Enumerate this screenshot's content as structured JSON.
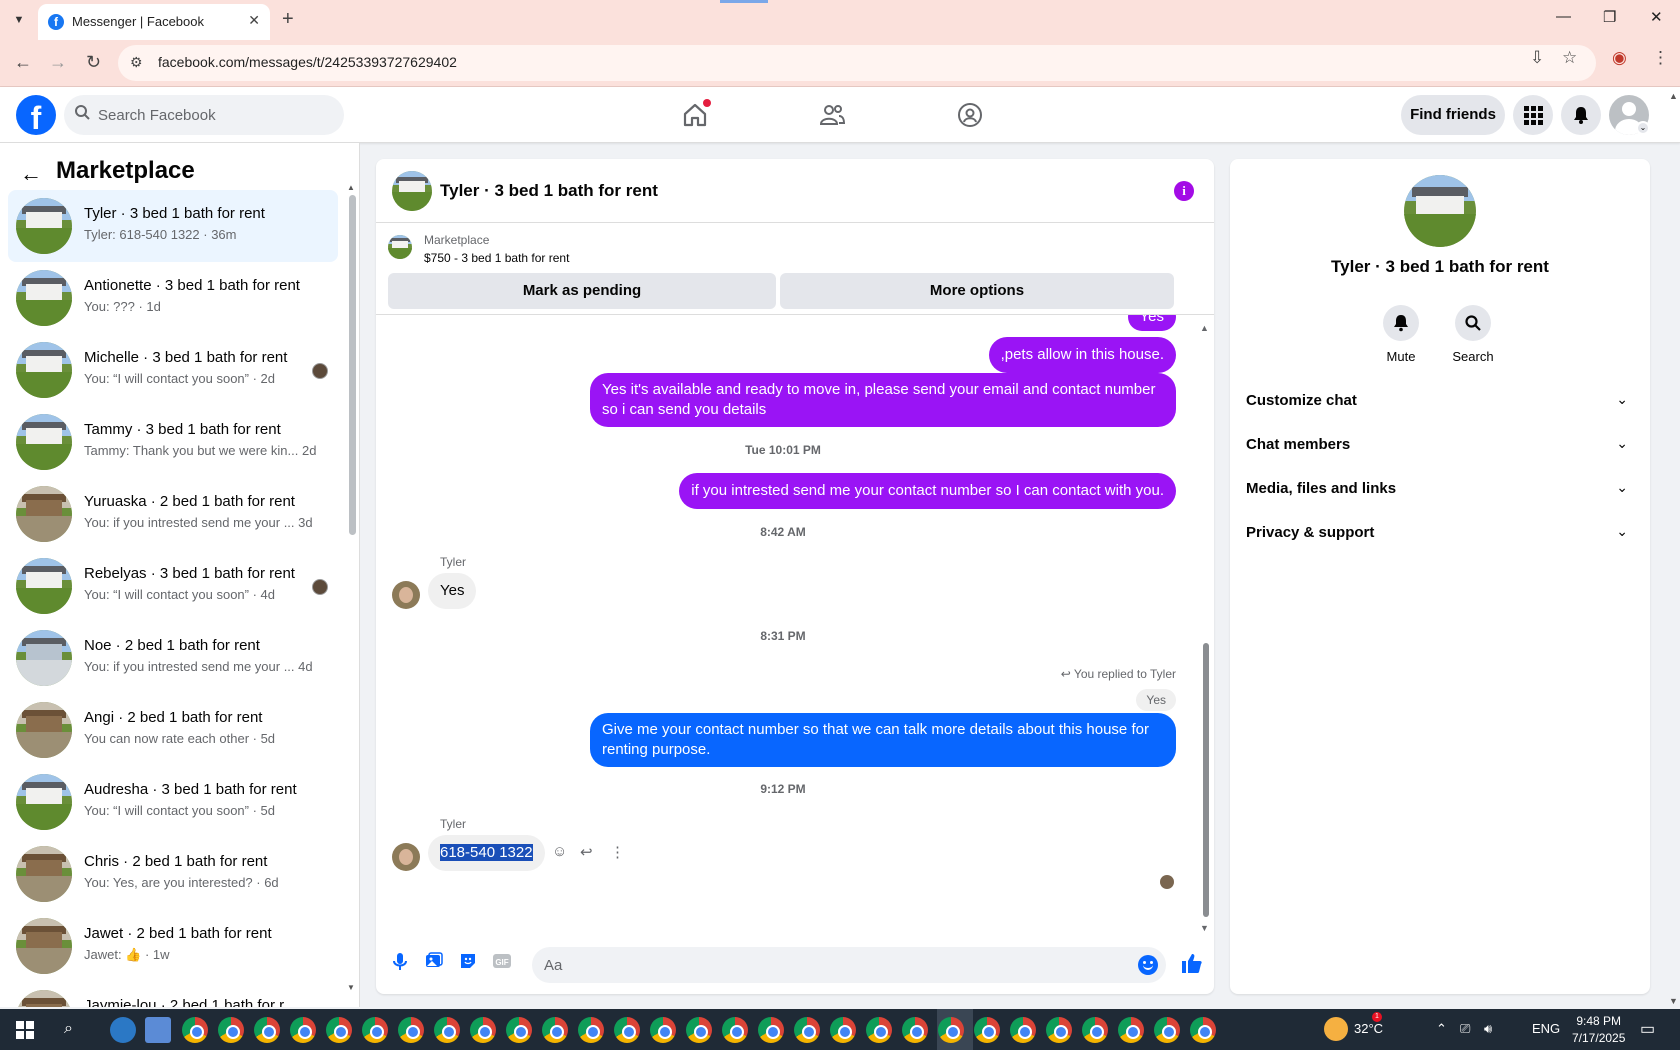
{
  "browser": {
    "tab_title": "Messenger | Facebook",
    "url": "facebook.com/messages/t/24253393727629402"
  },
  "fb_nav": {
    "search_placeholder": "Search Facebook",
    "find_friends": "Find friends"
  },
  "sidebar": {
    "title": "Marketplace",
    "chats": [
      {
        "name": "Tyler · 3 bed 1 bath for rent",
        "preview": "Tyler: 618-540 1322 · 36m",
        "active": true
      },
      {
        "name": "Antionette · 3 bed 1 bath for rent",
        "preview": "You: ??? · 1d"
      },
      {
        "name": "Michelle · 3 bed 1 bath for rent",
        "preview": "You: “I will contact you soon” · 2d",
        "seen": true
      },
      {
        "name": "Tammy · 3 bed 1 bath for rent",
        "preview": "Tammy: Thank you but we were kin... 2d"
      },
      {
        "name": "Yuruaska · 2 bed 1 bath for rent",
        "preview": "You: if you intrested send me your ... 3d",
        "thumb": "brown"
      },
      {
        "name": "Rebelyas · 3 bed 1 bath for rent",
        "preview": "You: “I will contact you soon” · 4d",
        "seen": true
      },
      {
        "name": "Noe · 2 bed 1 bath for rent",
        "preview": "You: if you intrested send me your ... 4d",
        "thumb": "blue"
      },
      {
        "name": "Angi · 2 bed 1 bath for rent",
        "preview": "You can now rate each other · 5d",
        "thumb": "brown"
      },
      {
        "name": "Audresha · 3 bed 1 bath for rent",
        "preview": "You: “I will contact you soon” · 5d"
      },
      {
        "name": "Chris · 2 bed 1 bath for rent",
        "preview": "You: Yes, are you interested? · 6d",
        "thumb": "brown"
      },
      {
        "name": "Jawet · 2 bed 1 bath for rent",
        "preview": "Jawet: 👍 · 1w",
        "thumb": "brown"
      },
      {
        "name": "Jaymie-lou · 2 bed 1 bath for r...",
        "preview": "",
        "thumb": "brown"
      }
    ]
  },
  "conversation": {
    "title": "Tyler · 3 bed 1 bath for rent",
    "marketplace_label": "Marketplace",
    "listing": "$750 - 3 bed 1 bath for rent",
    "mark_pending": "Mark as pending",
    "more_options": "More options",
    "msg_yes_top": "Yes",
    "msg_pets": ",pets allow in this house.",
    "msg_available": "Yes it's available and ready to move in, please send your email and contact number so i can send you details",
    "ts_1": "Tue 10:01 PM",
    "msg_interested": "if you intrested send me your contact number so I can contact with you.",
    "ts_2": "8:42 AM",
    "sender_1": "Tyler",
    "msg_tyler_yes": "Yes",
    "ts_3": "8:31 PM",
    "reply_note": "You replied to Tyler",
    "quoted": "Yes",
    "msg_give": "Give me your contact number so that we can talk more details about this house for renting purpose.",
    "ts_4": "9:12 PM",
    "sender_2": "Tyler",
    "msg_phone": "618-540 1322",
    "composer_placeholder": "Aa"
  },
  "info_panel": {
    "title": "Tyler · 3 bed 1 bath for rent",
    "mute": "Mute",
    "search": "Search",
    "sections": [
      "Customize chat",
      "Chat members",
      "Media, files and links",
      "Privacy & support"
    ]
  },
  "taskbar": {
    "temperature": "32°C",
    "language": "ENG",
    "time": "9:48 PM",
    "date": "7/17/2025",
    "weather_badge": "1"
  },
  "colors": {
    "fb_blue": "#0866ff",
    "purple_bubble": "#9a14f5",
    "tabbar_bg": "#fbe1dc"
  }
}
